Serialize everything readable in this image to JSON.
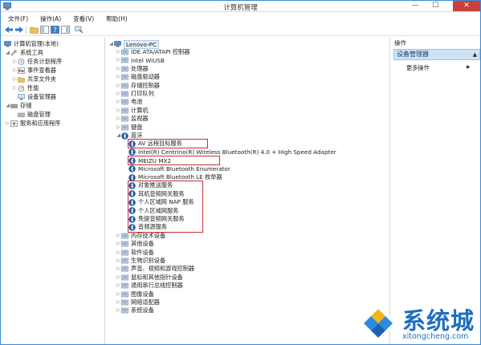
{
  "window": {
    "title": "计算机管理"
  },
  "title_controls": {
    "minimize": "—",
    "maximize": "☐",
    "close": "✕"
  },
  "menu": [
    "文件(F)",
    "操作(A)",
    "查看(V)",
    "帮助(H)"
  ],
  "left_tree": [
    {
      "label": "计算机管理(本地)",
      "icon": "computer-management-icon",
      "arrow": ""
    },
    {
      "label": "系统工具",
      "icon": "tools-icon",
      "arrow": "◢"
    },
    {
      "label": "任务计划程序",
      "icon": "clock-icon",
      "arrow": "▷"
    },
    {
      "label": "事件查看器",
      "icon": "event-viewer-icon",
      "arrow": "▷"
    },
    {
      "label": "共享文件夹",
      "icon": "shared-folder-icon",
      "arrow": "▷"
    },
    {
      "label": "性能",
      "icon": "performance-icon",
      "arrow": "▷"
    },
    {
      "label": "设备管理器",
      "icon": "device-manager-icon",
      "arrow": ""
    },
    {
      "label": "存储",
      "icon": "storage-icon",
      "arrow": "◢"
    },
    {
      "label": "磁盘管理",
      "icon": "disk-icon",
      "arrow": ""
    },
    {
      "label": "服务和应用程序",
      "icon": "services-icon",
      "arrow": "▷"
    }
  ],
  "device_tree": {
    "root": "Lenovo-PC",
    "categories": [
      {
        "label": "IDE ATA/ATAPI 控制器",
        "icon": "ide-icon",
        "arrow": "▷"
      },
      {
        "label": "Intel WiUSB",
        "icon": "usb-icon",
        "arrow": "▷"
      },
      {
        "label": "处理器",
        "icon": "processor-icon",
        "arrow": "▷"
      },
      {
        "label": "磁盘驱动器",
        "icon": "disk-drive-icon",
        "arrow": "▷"
      },
      {
        "label": "存储控制器",
        "icon": "storage-controller-icon",
        "arrow": "▷"
      },
      {
        "label": "打印队列",
        "icon": "printer-icon",
        "arrow": "▷"
      },
      {
        "label": "电池",
        "icon": "battery-icon",
        "arrow": "▷"
      },
      {
        "label": "计算机",
        "icon": "computer-icon",
        "arrow": "▷"
      },
      {
        "label": "监视器",
        "icon": "monitor-icon",
        "arrow": "▷"
      },
      {
        "label": "键盘",
        "icon": "keyboard-icon",
        "arrow": "▷"
      },
      {
        "label": "蓝牙",
        "icon": "bluetooth-icon",
        "arrow": "◢"
      }
    ],
    "bluetooth_children": [
      "AV 远程目标服务",
      "Intel(R) Centrino(R) Wireless Bluetooth(R) 4.0 + High Speed Adapter",
      "MEIZU MX2",
      "Microsoft Bluetooth Enumerator",
      "Microsoft Bluetooth LE 枚举器",
      "对象推送服务",
      "耳机音频网关服务",
      "个人区域网 NAP 服务",
      "个人区域网服务",
      "免提音频网关服务",
      "音频源服务"
    ],
    "more_categories": [
      {
        "label": "内存技术设备",
        "icon": "memory-icon",
        "arrow": "▷"
      },
      {
        "label": "其他设备",
        "icon": "other-devices-icon",
        "arrow": "▷"
      },
      {
        "label": "软件设备",
        "icon": "software-device-icon",
        "arrow": "▷"
      },
      {
        "label": "生物识别设备",
        "icon": "biometric-icon",
        "arrow": "▷"
      },
      {
        "label": "声音、视频和游戏控制器",
        "icon": "sound-icon",
        "arrow": "▷"
      },
      {
        "label": "鼠标和其他指针设备",
        "icon": "mouse-icon",
        "arrow": "▷"
      },
      {
        "label": "通用串行总线控制器",
        "icon": "usb-controller-icon",
        "arrow": "▷"
      },
      {
        "label": "图像设备",
        "icon": "camera-icon",
        "arrow": "▷"
      },
      {
        "label": "网络适配器",
        "icon": "network-icon",
        "arrow": "▷"
      },
      {
        "label": "系统设备",
        "icon": "system-device-icon",
        "arrow": "▷"
      }
    ]
  },
  "actions_pane": {
    "header": "操作",
    "section": "设备管理器",
    "item": "更多操作",
    "caret": "▲",
    "item_caret": "▶"
  },
  "watermark": {
    "brand": "系统城",
    "url": "xitongcheng.com"
  },
  "colors": {
    "highlight": "#c73035",
    "bluetooth": "#1b4f9c",
    "accent": "#1d6fc1",
    "selection": "#cde3f4"
  }
}
